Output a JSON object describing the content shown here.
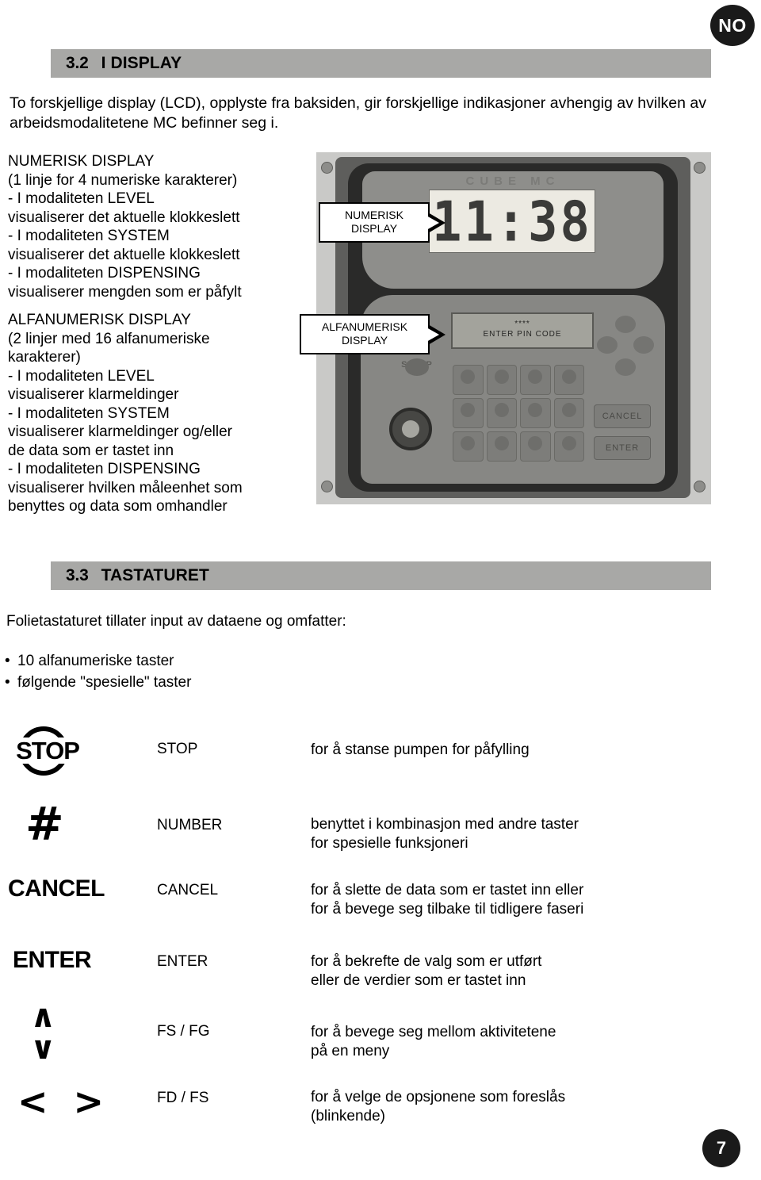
{
  "language_badge": "NO",
  "page_number": "7",
  "sections": {
    "display": {
      "number": "3.2",
      "title": "I DISPLAY",
      "intro": "To forskjellige display (LCD), opplyste fra baksiden, gir forskjellige indikasjoner avhengig av hvilken av arbeidsmodalitetene MC befinner seg i.",
      "numeric_block": "NUMERISK DISPLAY\n(1 linje for 4 numeriske karakterer)\n-  I modaliteten LEVEL\n   visualiserer det aktuelle klokkeslett\n-  I modaliteten SYSTEM\n   visualiserer det aktuelle klokkeslett\n-  I modaliteten DISPENSING\n   visualiserer mengden som er påfylt",
      "alfa_block": "ALFANUMERISK DISPLAY\n(2 linjer med 16 alfanumeriske\nkarakterer)\n-  I modaliteten LEVEL\n   visualiserer klarmeldinger\n-  I modaliteten SYSTEM\n   visualiserer klarmeldinger og/eller\n   de data som er tastet inn\n-  I modaliteten DISPENSING\n   visualiserer hvilken måleenhet som\n   benyttes og data som omhandler"
    },
    "keypad": {
      "number": "3.3",
      "title": "TASTATURET",
      "intro": "Folietastaturet tillater input av dataene og omfatter:",
      "bullets": [
        "10 alfanumeriske taster",
        "følgende \"spesielle\" taster"
      ]
    }
  },
  "photo": {
    "brand": "CUBE MC",
    "numeric_display_value": "11:38",
    "alfa_display_line1": "****",
    "alfa_display_line2": "ENTER PIN CODE",
    "stop_label": "STOP",
    "cancel_label": "CANCEL",
    "enter_label": "ENTER"
  },
  "callouts": {
    "numeric": "NUMERISK\nDISPLAY",
    "alfanumeric": "ALFANUMERISK\nDISPLAY"
  },
  "key_table": [
    {
      "glyph": "STOP",
      "glyph_type": "stop-sign-icon",
      "name": "STOP",
      "description": "for å stanse pumpen for påfylling"
    },
    {
      "glyph": "#",
      "glyph_type": "hash-icon",
      "name": "NUMBER",
      "description": "benyttet i kombinasjon med andre taster\nfor spesielle funksjoneri"
    },
    {
      "glyph": "CANCEL",
      "glyph_type": "cancel-word-icon",
      "name": "CANCEL",
      "description": "for å slette de data som er tastet inn eller\nfor å bevege seg tilbake til tidligere faseri"
    },
    {
      "glyph": "ENTER",
      "glyph_type": "enter-word-icon",
      "name": "ENTER",
      "description": "for å bekrefte de valg som er utført\neller de verdier som er tastet inn"
    },
    {
      "glyph": "∧\n∨",
      "glyph_type": "up-down-arrows-icon",
      "name": "FS / FG",
      "description": "for å bevege seg mellom aktivitetene\npå en meny"
    },
    {
      "glyph": "< >",
      "glyph_type": "left-right-arrows-icon",
      "name": "FD / FS",
      "description": "for å velge de opsjonene som foreslås\n(blinkende)"
    }
  ],
  "colors": {
    "section_bar": "#a8a8a6",
    "badge": "#1a1a1a",
    "text": "#000000"
  }
}
